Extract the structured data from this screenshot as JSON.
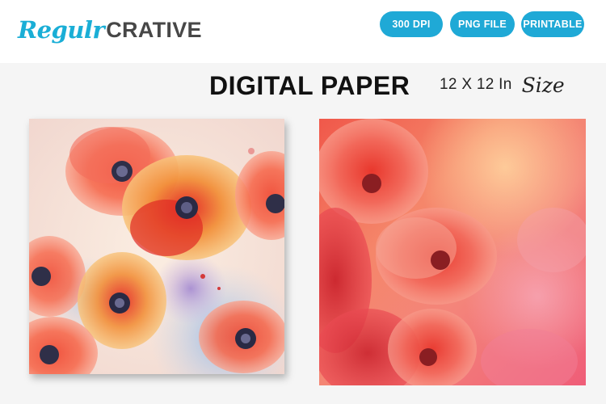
{
  "brand": {
    "logo_script": "Regulr",
    "logo_block": "CRATIVE",
    "primary_color": "#1aaed6",
    "secondary_color": "#474747"
  },
  "badges": [
    {
      "label": "300 DPI"
    },
    {
      "label": "PNG FILE"
    },
    {
      "label": "PRINTABLE"
    }
  ],
  "badge_color": "#1fa9d6",
  "title": "DIGITAL PAPER",
  "size": {
    "text": "12 X 12 In",
    "script": "Size"
  },
  "previews": [
    {
      "description_icon": "watercolor-poppy-pattern-light"
    },
    {
      "description_icon": "watercolor-poppy-pattern-red"
    }
  ]
}
